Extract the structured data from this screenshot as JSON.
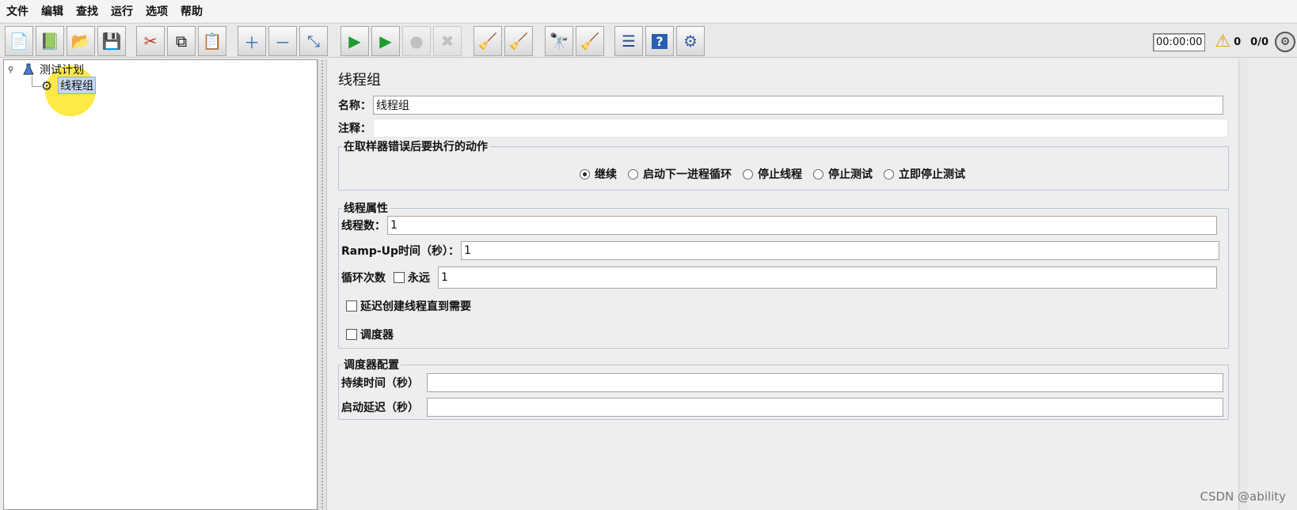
{
  "menu": [
    "文件",
    "编辑",
    "查找",
    "运行",
    "选项",
    "帮助"
  ],
  "toolbar": {
    "buttons": [
      {
        "name": "new-icon",
        "glyph": "📄"
      },
      {
        "name": "templates-icon",
        "glyph": "📗"
      },
      {
        "name": "open-icon",
        "glyph": "📂"
      },
      {
        "name": "save-icon",
        "glyph": "💾"
      },
      {
        "name": "cut-icon",
        "glyph": "✂"
      },
      {
        "name": "copy-icon",
        "glyph": "⧉"
      },
      {
        "name": "paste-icon",
        "glyph": "📋"
      },
      {
        "name": "expand-icon",
        "glyph": "＋"
      },
      {
        "name": "collapse-icon",
        "glyph": "－"
      },
      {
        "name": "toggle-icon",
        "glyph": "⤡"
      },
      {
        "name": "start-icon",
        "glyph": "▶"
      },
      {
        "name": "start-no-pause-icon",
        "glyph": "▶"
      },
      {
        "name": "stop-icon",
        "glyph": "●"
      },
      {
        "name": "shutdown-icon",
        "glyph": "✖"
      },
      {
        "name": "clear-icon",
        "glyph": "🧹"
      },
      {
        "name": "clear-all-icon",
        "glyph": "🧹"
      },
      {
        "name": "search-icon",
        "glyph": "🔭"
      },
      {
        "name": "reset-search-icon",
        "glyph": "🧹"
      },
      {
        "name": "function-helper-icon",
        "glyph": "☰"
      },
      {
        "name": "help-icon",
        "glyph": "?"
      },
      {
        "name": "remote-icon",
        "glyph": "⚙"
      }
    ],
    "timer": "00:00:00",
    "warning_count": "0",
    "threads": "0/0"
  },
  "tree": {
    "root_label": "测试计划",
    "child_label": "线程组"
  },
  "panel": {
    "title": "线程组",
    "name_label": "名称：",
    "name_value": "线程组",
    "comment_label": "注释：",
    "comment_value": "",
    "error_group_title": "在取样器错误后要执行的动作",
    "error_options": [
      "继续",
      "启动下一进程循环",
      "停止线程",
      "停止测试",
      "立即停止测试"
    ],
    "thread_group_title": "线程属性",
    "threads_label": "线程数：",
    "threads_value": "1",
    "rampup_label": "Ramp-Up时间（秒）：",
    "rampup_value": "1",
    "loop_label": "循环次数",
    "forever_label": "永远",
    "loop_value": "1",
    "delay_label": "延迟创建线程直到需要",
    "scheduler_label": "调度器",
    "scheduler_group_title": "调度器配置",
    "duration_label": "持续时间（秒）",
    "duration_value": "",
    "startup_delay_label": "启动延迟（秒）",
    "startup_delay_value": ""
  },
  "watermark": "CSDN @ability"
}
